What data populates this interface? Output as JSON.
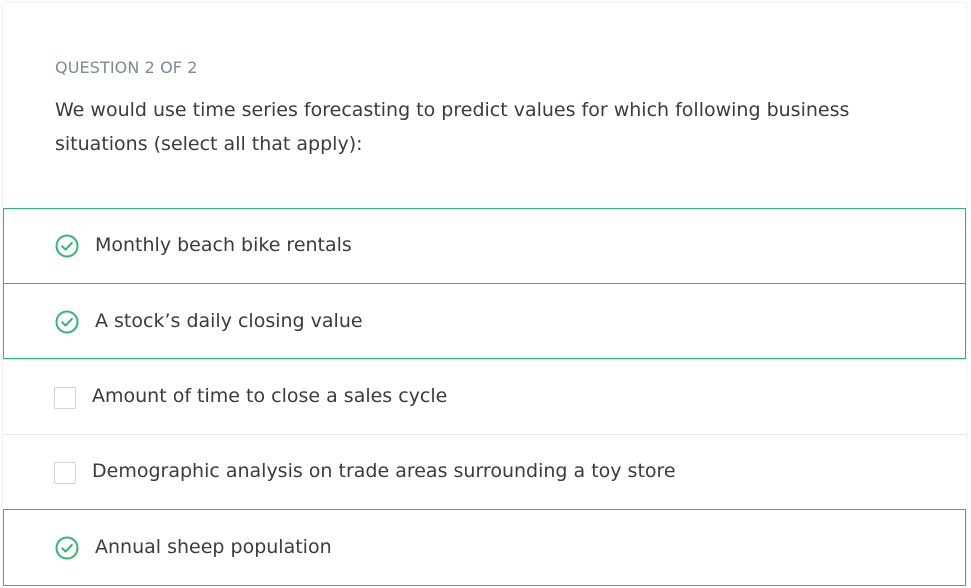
{
  "question": {
    "counter": "QUESTION 2 OF 2",
    "text": "We would use time series forecasting to predict values for which following business situations (select all that apply):"
  },
  "options": [
    {
      "label": "Monthly beach bike rentals",
      "selected": true
    },
    {
      "label": "A stock’s daily closing value",
      "selected": true
    },
    {
      "label": "Amount of time to close a sales cycle",
      "selected": false
    },
    {
      "label": "Demographic analysis on trade areas surrounding a toy store",
      "selected": false
    },
    {
      "label": "Annual sheep population",
      "selected": true
    }
  ],
  "colors": {
    "accent": "#2eb872",
    "counter_text": "#7a8a99",
    "body_text": "#3b3b3b"
  },
  "icons": {
    "selected": "check-circle-icon",
    "unselected": "empty-checkbox"
  }
}
